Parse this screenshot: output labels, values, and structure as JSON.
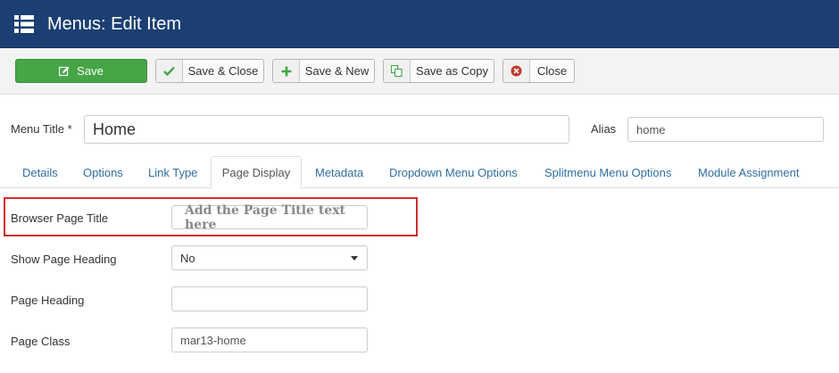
{
  "header": {
    "title": "Menus: Edit Item",
    "menu_icon": "list-icon",
    "bg_color": "#1b3f72"
  },
  "toolbar": {
    "save_label": "Save",
    "save_close_label": "Save & Close",
    "save_new_label": "Save & New",
    "save_copy_label": "Save as Copy",
    "close_label": "Close",
    "save_color": "#46a546"
  },
  "form": {
    "menu_title_label": "Menu Title *",
    "menu_title_value": "Home",
    "alias_label": "Alias",
    "alias_value": "home"
  },
  "tabs": [
    {
      "label": "Details"
    },
    {
      "label": "Options"
    },
    {
      "label": "Link Type"
    },
    {
      "label": "Page Display",
      "active": true
    },
    {
      "label": "Metadata"
    },
    {
      "label": "Dropdown Menu Options"
    },
    {
      "label": "Splitmenu Menu Options"
    },
    {
      "label": "Module Assignment"
    }
  ],
  "page_display": {
    "browser_title_label": "Browser Page Title",
    "browser_title_placeholder": "Add the Page Title text here",
    "show_heading_label": "Show Page Heading",
    "show_heading_value": "No",
    "page_heading_label": "Page Heading",
    "page_heading_value": "",
    "page_class_label": "Page Class",
    "page_class_value": "mar13-home"
  },
  "highlight_color": "#d62b2b"
}
